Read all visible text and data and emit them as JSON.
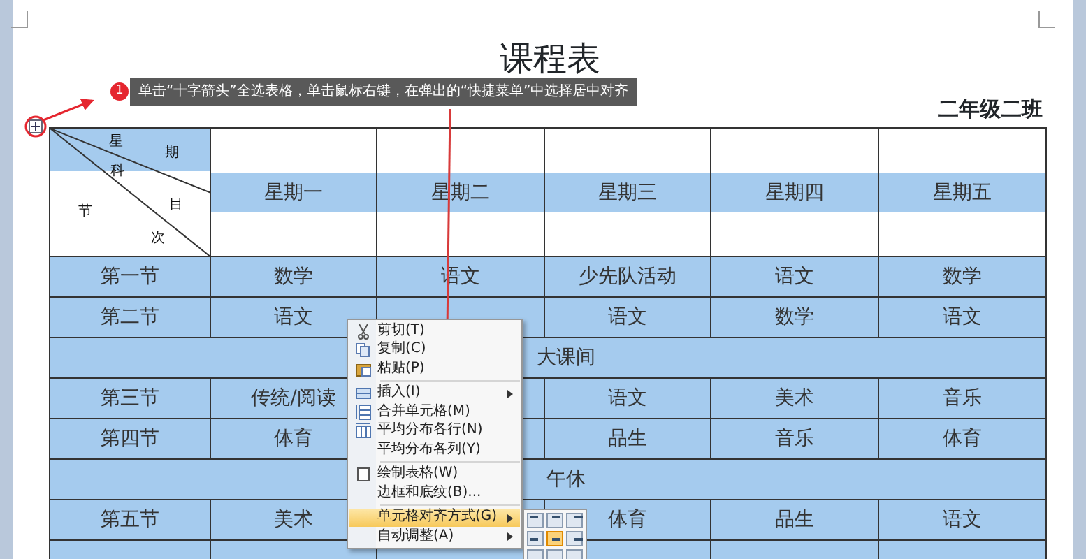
{
  "document": {
    "title": "课程表",
    "class_name": "二年级二班"
  },
  "callout": {
    "badge": "1",
    "text": "单击“十字箭头”全选表格，单击鼠标右键，在弹出的“快捷菜单”中选择居中对齐"
  },
  "table": {
    "corner_labels": [
      "星",
      "期",
      "科",
      "目",
      "节",
      "次"
    ],
    "days": [
      "星期一",
      "星期二",
      "星期三",
      "星期四",
      "星期五"
    ],
    "rows": [
      {
        "kind": "lesson",
        "cells": [
          "第一节",
          "数学",
          "语文",
          "少先队活动",
          "语文",
          "数学"
        ]
      },
      {
        "kind": "lesson",
        "cells": [
          "第二节",
          "语文",
          null,
          "语文",
          "数学",
          "语文"
        ]
      },
      {
        "kind": "break",
        "text": "大课间"
      },
      {
        "kind": "lesson",
        "cells": [
          "第三节",
          "传统/阅读",
          null,
          "语文",
          "美术",
          "音乐"
        ]
      },
      {
        "kind": "lesson",
        "cells": [
          "第四节",
          "体育",
          null,
          "品生",
          "音乐",
          "体育"
        ]
      },
      {
        "kind": "break",
        "text": "午休"
      },
      {
        "kind": "lesson",
        "cells": [
          "第五节",
          "美术",
          null,
          "体育",
          "品生",
          "语文"
        ]
      },
      {
        "kind": "lesson",
        "cells": [
          null,
          null,
          null,
          null,
          null,
          null
        ]
      }
    ]
  },
  "context_menu": {
    "items": [
      {
        "kind": "command",
        "label": "剪切(T)",
        "selected": false
      },
      {
        "kind": "command",
        "label": "复制(C)",
        "selected": false
      },
      {
        "kind": "command",
        "label": "粘贴(P)",
        "selected": false
      },
      {
        "kind": "separator"
      },
      {
        "kind": "submenu",
        "label": "插入(I)",
        "selected": false
      },
      {
        "kind": "command",
        "label": "合并单元格(M)",
        "selected": false
      },
      {
        "kind": "command",
        "label": "平均分布各行(N)",
        "selected": false
      },
      {
        "kind": "command",
        "label": "平均分布各列(Y)",
        "selected": false
      },
      {
        "kind": "separator"
      },
      {
        "kind": "command",
        "label": "绘制表格(W)",
        "selected": false
      },
      {
        "kind": "command",
        "label": "边框和底纹(B)...",
        "selected": false
      },
      {
        "kind": "separator"
      },
      {
        "kind": "submenu",
        "label": "单元格对齐方式(G)",
        "selected": true
      },
      {
        "kind": "submenu",
        "label": "自动调整(A)",
        "selected": false
      }
    ],
    "alignment_options": [
      {
        "selected": false
      },
      {
        "selected": false
      },
      {
        "selected": false
      },
      {
        "selected": false
      },
      {
        "selected": true
      },
      {
        "selected": false
      },
      {
        "selected": false
      },
      {
        "selected": false
      },
      {
        "selected": false
      }
    ]
  }
}
